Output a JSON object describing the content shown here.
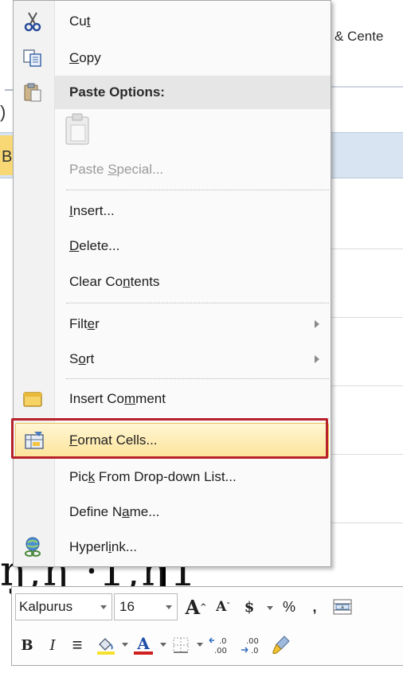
{
  "background": {
    "ribbon_partial_text": "& Cente",
    "left_paren": ")",
    "left_b": "B",
    "cell_partial_text": "ŋ,ŋ ⸱1,ŋ1"
  },
  "context_menu": {
    "items": [
      {
        "id": "cut",
        "label_pre": "Cu",
        "label_key": "t",
        "label_post": "",
        "icon": "scissors-icon"
      },
      {
        "id": "copy",
        "label_pre": "",
        "label_key": "C",
        "label_post": "opy",
        "icon": "copy-icon"
      },
      {
        "id": "paste-options",
        "label": "Paste Options:",
        "icon": "clipboard-icon"
      },
      {
        "id": "paste-default",
        "icon": "paste-default-icon"
      },
      {
        "id": "paste-special",
        "label_pre": "Paste ",
        "label_key": "S",
        "label_post": "pecial...",
        "disabled": true
      },
      {
        "id": "insert",
        "label_pre": "",
        "label_key": "I",
        "label_post": "nsert..."
      },
      {
        "id": "delete",
        "label_pre": "",
        "label_key": "D",
        "label_post": "elete..."
      },
      {
        "id": "clear-contents",
        "label_pre": "Clear Co",
        "label_key": "n",
        "label_post": "tents"
      },
      {
        "id": "filter",
        "label_pre": "Filt",
        "label_key": "e",
        "label_post": "r",
        "submenu": true
      },
      {
        "id": "sort",
        "label_pre": "S",
        "label_key": "o",
        "label_post": "rt",
        "submenu": true
      },
      {
        "id": "insert-comment",
        "label_pre": "Insert Co",
        "label_key": "m",
        "label_post": "ment",
        "icon": "comment-icon"
      },
      {
        "id": "format-cells",
        "label_pre": "",
        "label_key": "F",
        "label_post": "ormat Cells...",
        "icon": "format-cells-icon",
        "highlighted": true
      },
      {
        "id": "pick-dropdown",
        "label_pre": "Pic",
        "label_key": "k",
        "label_post": " From Drop-down List..."
      },
      {
        "id": "define-name",
        "label_pre": "Define N",
        "label_key": "a",
        "label_post": "me..."
      },
      {
        "id": "hyperlink",
        "label_pre": "Hyperl",
        "label_key": "i",
        "label_post": "nk...",
        "icon": "hyperlink-icon"
      }
    ]
  },
  "mini_toolbar": {
    "font_name": "Kalpurus",
    "font_size": "16",
    "grow_font": "A",
    "shrink_font": "A",
    "currency": "$",
    "percent": "%",
    "comma": ",",
    "bold": "B",
    "italic": "I",
    "align": "≡",
    "font_color_letter": "A",
    "increase_decimal": "←.0\n.00",
    "decrease_decimal": ".00\n→.0",
    "colors": {
      "fill_highlight": "#f6e12d",
      "font_color_bar": "#d01f1f"
    }
  },
  "colors": {
    "highlight_outline": "#b8202a",
    "highlight_fill_top": "#fff6d4",
    "highlight_fill_bottom": "#fde49a"
  }
}
